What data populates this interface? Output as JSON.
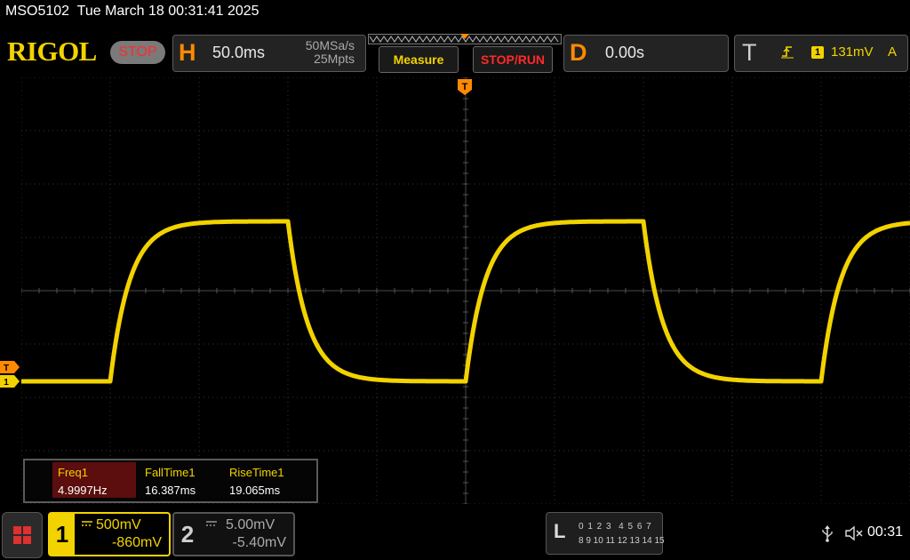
{
  "status": {
    "model": "MSO5102",
    "datetime": "Tue March 18 00:31:41 2025"
  },
  "header": {
    "brand": "RIGOL",
    "run_state": "STOP",
    "horizontal": {
      "letter": "H",
      "timebase": "50.0ms",
      "sample_rate": "50MSa/s",
      "memory_depth": "25Mpts"
    },
    "measure_label": "Measure",
    "stoprun_label": "STOP/RUN",
    "delay": {
      "letter": "D",
      "value": "0.00s"
    },
    "trigger": {
      "letter": "T",
      "source": "1",
      "level": "131mV",
      "mode": "A",
      "edge_icon": "rising-edge-icon"
    }
  },
  "markers": {
    "trigger_position": "T",
    "trigger_level": "T",
    "ch1": "1"
  },
  "measurements": [
    {
      "name": "Freq1",
      "value": "4.9997Hz"
    },
    {
      "name": "FallTime1",
      "value": "16.387ms"
    },
    {
      "name": "RiseTime1",
      "value": "19.065ms"
    }
  ],
  "channels": [
    {
      "number": "1",
      "scale": "500mV",
      "offset": "-860mV",
      "coupling_icon": "dc-coupling-icon",
      "color": "#f2d300",
      "active": true
    },
    {
      "number": "2",
      "scale": "5.00mV",
      "offset": "-5.40mV",
      "coupling_icon": "dc-coupling-icon",
      "color": "#8a8a8a",
      "active": false
    }
  ],
  "logic_analyzer": {
    "letter": "L",
    "row1": "0 1 2 3  4 5 6 7",
    "row2": "8 9 10 11 12 13 14 15"
  },
  "footer": {
    "time": "00:31",
    "usb_icon": "usb-icon",
    "sound_icon": "mute-icon"
  },
  "waveform": {
    "channel": "1",
    "signal": "square-wave with exponential rise/fall",
    "rise_start_div": [
      1.0,
      5.0,
      9.0
    ],
    "fall_start_div": [
      3.0,
      7.0
    ],
    "high_level_div_from_top": 2.7,
    "low_level_div_from_top": 5.7
  },
  "colors": {
    "ch1": "#f2d300",
    "brand": "#f2d300",
    "accent_orange": "#ff8a00",
    "stop_red": "#ff2a2a",
    "grid": "#3a3a3a"
  }
}
